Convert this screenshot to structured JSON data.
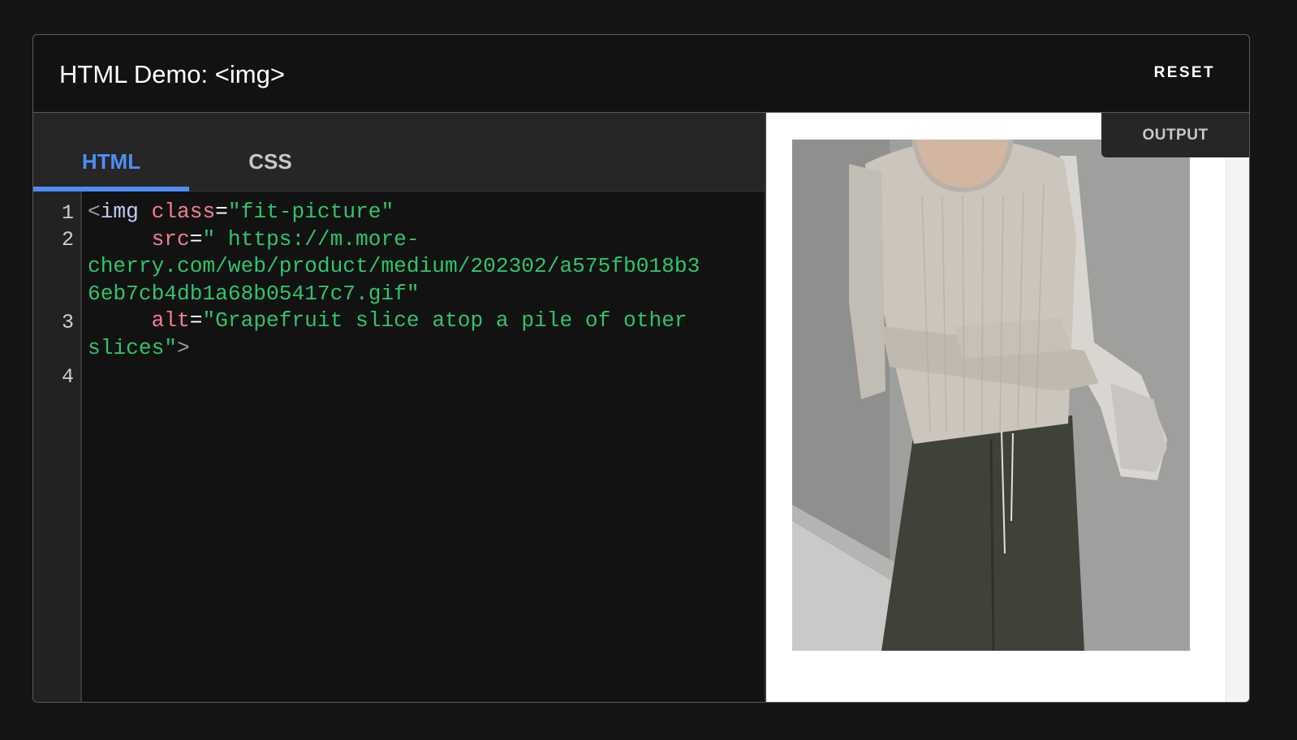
{
  "header": {
    "title": "HTML Demo: <img>",
    "reset_label": "RESET"
  },
  "tabs": [
    {
      "label": "HTML",
      "active": true
    },
    {
      "label": "CSS",
      "active": false
    }
  ],
  "line_numbers": [
    "1",
    "2",
    "3",
    "4"
  ],
  "code": {
    "l1": {
      "open": "<",
      "tag": "img",
      "attr": "class",
      "eq": "=",
      "value": "\"fit-picture\""
    },
    "l2": {
      "attr": "src",
      "eq": "=",
      "value_a": "\" https://m.more-",
      "value_b": "cherry.com/web/product/medium/202302/a575fb018b3",
      "value_c": "6eb7cb4db1a68b05417c7.gif\""
    },
    "l3": {
      "attr": "alt",
      "eq": "=",
      "value_a": "\"Grapefruit slice atop a pile of other",
      "value_b": "slices\"",
      "close": ">"
    }
  },
  "output": {
    "label": "OUTPUT",
    "image_icon": "photo-person-ribbed-top"
  },
  "colors": {
    "background": "#151515",
    "accent": "#4d8ef5",
    "attr": "#f47d8d",
    "string": "#2fc46a",
    "tag": "#c2c8f5"
  }
}
